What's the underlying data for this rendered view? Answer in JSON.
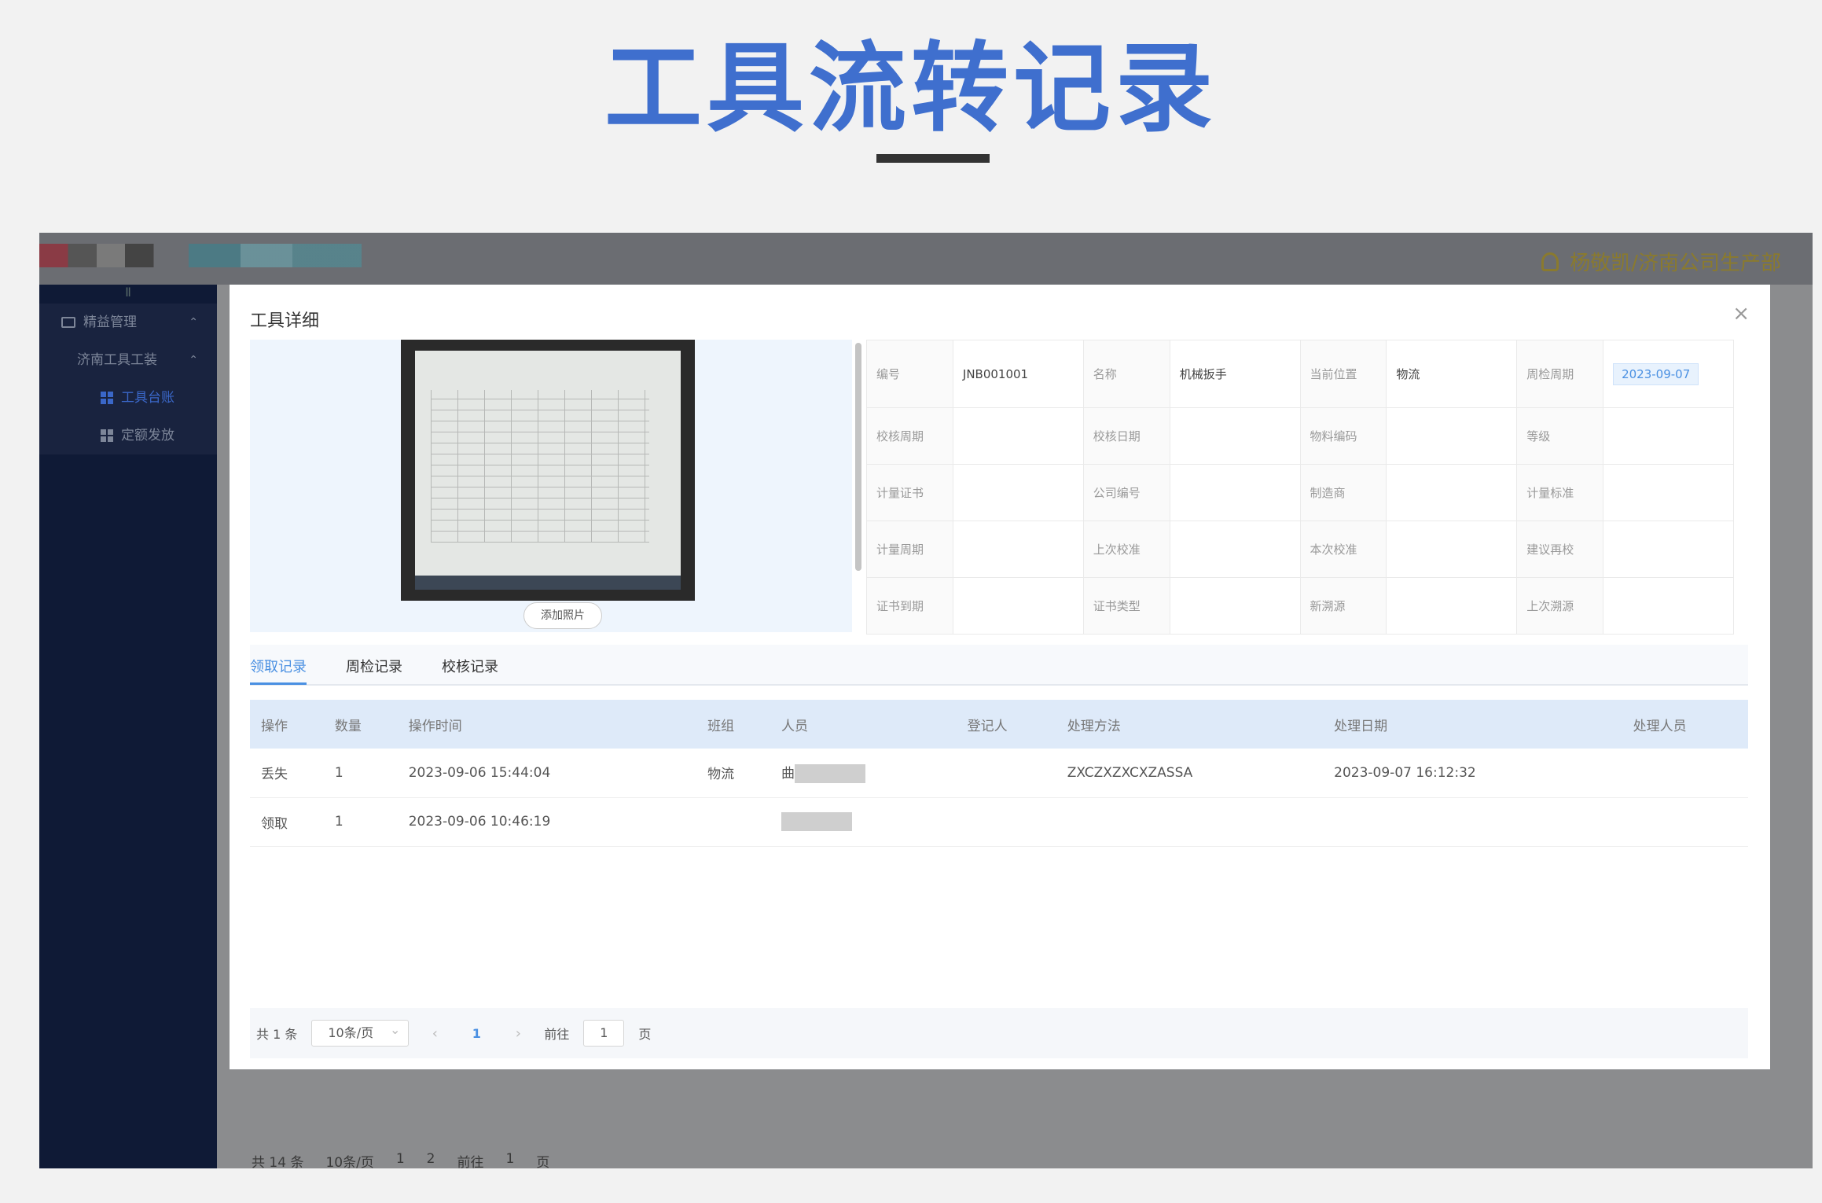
{
  "page": {
    "title": "工具流转记录",
    "colors": {
      "title": "#3f6fce",
      "sidebar": "#0f1a36",
      "accent": "#4a90e2"
    }
  },
  "app": {
    "user": "杨敬凯/济南公司生产部",
    "sidebar": [
      {
        "label": "精益管理",
        "icon": "box-icon"
      },
      {
        "label": "济南工具工装",
        "icon": ""
      },
      {
        "label": "工具台账",
        "icon": "grid-icon",
        "active": true
      },
      {
        "label": "定额发放",
        "icon": "grid-icon"
      }
    ],
    "bg_pager": {
      "total": "共 14 条",
      "page_size": "10条/页",
      "page1": "1",
      "page2": "2",
      "goto": "前往",
      "goto_value": "1",
      "page_unit": "页"
    }
  },
  "modal": {
    "title": "工具详细",
    "close": "×",
    "add_photo": "添加照片",
    "info": [
      [
        {
          "label": "编号",
          "value": "JNB001001"
        },
        {
          "label": "名称",
          "value": "机械扳手"
        },
        {
          "label": "当前位置",
          "value": "物流"
        },
        {
          "label": "周检周期",
          "value": "2023-09-07",
          "tag": true
        }
      ],
      [
        {
          "label": "校核周期",
          "value": ""
        },
        {
          "label": "校核日期",
          "value": ""
        },
        {
          "label": "物料编码",
          "value": ""
        },
        {
          "label": "等级",
          "value": ""
        }
      ],
      [
        {
          "label": "计量证书",
          "value": ""
        },
        {
          "label": "公司编号",
          "value": ""
        },
        {
          "label": "制造商",
          "value": ""
        },
        {
          "label": "计量标准",
          "value": ""
        }
      ],
      [
        {
          "label": "计量周期",
          "value": ""
        },
        {
          "label": "上次校准",
          "value": ""
        },
        {
          "label": "本次校准",
          "value": ""
        },
        {
          "label": "建议再校",
          "value": ""
        }
      ],
      [
        {
          "label": "证书到期",
          "value": ""
        },
        {
          "label": "证书类型",
          "value": ""
        },
        {
          "label": "新溯源",
          "value": ""
        },
        {
          "label": "上次溯源",
          "value": ""
        }
      ]
    ],
    "tabs": [
      "领取记录",
      "周检记录",
      "校核记录"
    ],
    "table": {
      "headers": [
        "操作",
        "数量",
        "操作时间",
        "班组",
        "人员",
        "登记人",
        "处理方法",
        "处理日期",
        "处理人员"
      ],
      "rows": [
        [
          "丢失",
          "1",
          "2023-09-06 15:44:04",
          "物流",
          "曲",
          "",
          "ZXCZXZXCXZASSA",
          "2023-09-07 16:12:32",
          ""
        ],
        [
          "领取",
          "1",
          "2023-09-06 10:46:19",
          "",
          "",
          "",
          "",
          "",
          ""
        ]
      ]
    },
    "pager": {
      "total": "共 1 条",
      "page_size": "10条/页",
      "current": "1",
      "goto": "前往",
      "goto_value": "1",
      "page_unit": "页"
    }
  }
}
